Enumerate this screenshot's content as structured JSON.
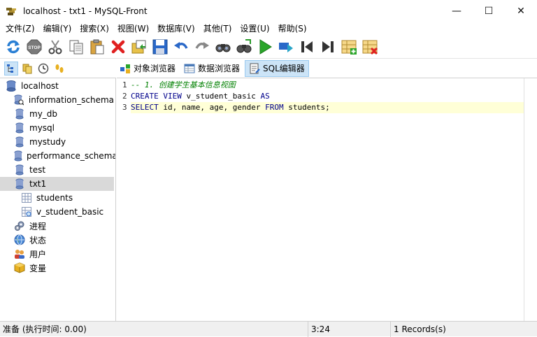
{
  "window": {
    "title": "localhost - txt1 - MySQL-Front",
    "controls": {
      "minimize": "—",
      "maximize": "☐",
      "close": "✕"
    }
  },
  "menu": [
    "文件(Z)",
    "编辑(Y)",
    "搜索(X)",
    "视图(W)",
    "数据库(V)",
    "其他(T)",
    "设置(U)",
    "帮助(S)"
  ],
  "toolbar": {
    "icons": [
      "refresh-icon",
      "stop-icon",
      "cut-icon",
      "copy-icon",
      "paste-icon",
      "delete-icon",
      "open-icon",
      "save-icon",
      "undo-icon",
      "redo-icon",
      "find-icon",
      "replace-icon",
      "run-icon",
      "run-selection-icon",
      "first-icon",
      "last-icon",
      "insert-row-icon",
      "delete-row-icon"
    ],
    "stop_label": "STOP"
  },
  "tabs": [
    {
      "label": "对象浏览器",
      "icon": "object-browser-icon",
      "active": false
    },
    {
      "label": "数据浏览器",
      "icon": "data-browser-icon",
      "active": false
    },
    {
      "label": "SQL编辑器",
      "icon": "sql-editor-icon",
      "active": true
    }
  ],
  "tree": {
    "root": "localhost",
    "databases": [
      "information_schema",
      "my_db",
      "mysql",
      "mystudy",
      "performance_schema",
      "test",
      "txt1"
    ],
    "selected": "txt1",
    "tables": [
      "students",
      "v_student_basic"
    ],
    "extras": [
      "进程",
      "状态",
      "用户",
      "变量"
    ]
  },
  "editor": {
    "lines": [
      {
        "num": "1",
        "comment": "-- 1. 创建学生基本信息视图"
      },
      {
        "num": "2",
        "kw1": "CREATE VIEW",
        "text1": " v_student_basic ",
        "kw2": "AS"
      },
      {
        "num": "3",
        "kw1": "SELECT",
        "text1": " id, name, age, gender ",
        "kw2": "FROM",
        "text2": " students;"
      }
    ]
  },
  "status": {
    "message": "准备  (执行时间: 0.00)",
    "position": "3:24",
    "records": "1 Records(s)"
  },
  "colors": {
    "selection": "#cce4f7",
    "current_line": "#ffffd7",
    "comment": "#008000",
    "keyword": "#00008b"
  }
}
